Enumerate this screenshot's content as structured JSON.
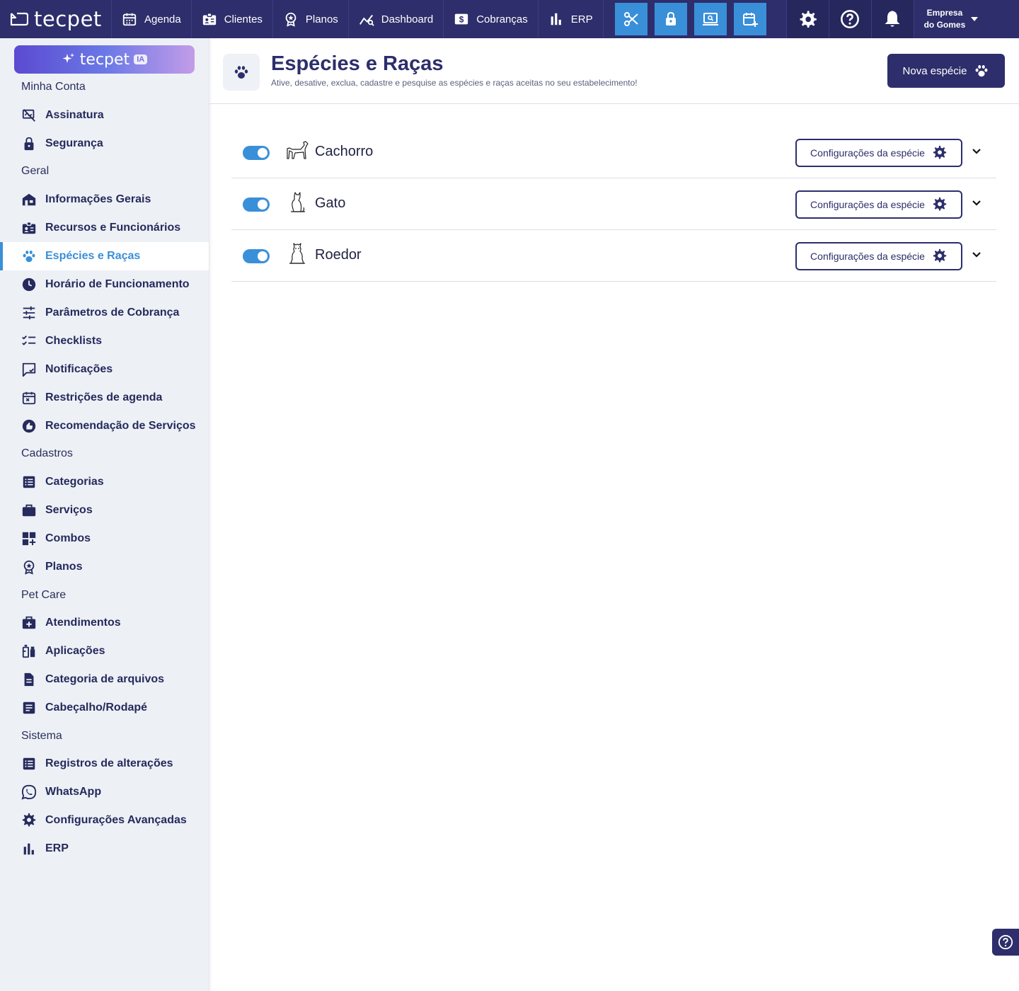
{
  "topbar": {
    "logo": "tecpet",
    "nav": [
      {
        "label": "Agenda",
        "icon": "calendar-icon"
      },
      {
        "label": "Clientes",
        "icon": "id-card-icon"
      },
      {
        "label": "Planos",
        "icon": "badge-icon"
      },
      {
        "label": "Dashboard",
        "icon": "chart-line-icon"
      },
      {
        "label": "Cobranças",
        "icon": "dollar-icon"
      },
      {
        "label": "ERP",
        "icon": "bar-chart-icon"
      }
    ],
    "quick_actions": [
      "scissors-icon",
      "lock-icon",
      "monitor-search-icon",
      "calendar-plus-icon"
    ],
    "tools": [
      "gear-icon",
      "help-icon",
      "bell-icon"
    ],
    "company_line1": "Empresa",
    "company_line2": "do Gomes"
  },
  "sidebar": {
    "ia_label": "tecpet",
    "ia_badge": "IA",
    "sections": {
      "account": "Minha Conta",
      "general": "Geral",
      "registry": "Cadastros",
      "petcare": "Pet Care",
      "system": "Sistema"
    },
    "items": {
      "assinatura": "Assinatura",
      "seguranca": "Segurança",
      "info": "Informações Gerais",
      "recursos": "Recursos e Funcionários",
      "especies": "Espécies e Raças",
      "horario": "Horário de Funcionamento",
      "parametros": "Parâmetros de Cobrança",
      "checklists": "Checklists",
      "notificacoes": "Notificações",
      "restricoes": "Restrições de agenda",
      "recomendacao": "Recomendação de Serviços",
      "categorias": "Categorias",
      "servicos": "Serviços",
      "combos": "Combos",
      "planos": "Planos",
      "atendimentos": "Atendimentos",
      "aplicacoes": "Aplicações",
      "cat_arquivos": "Categoria de arquivos",
      "cabecalho": "Cabeçalho/Rodapé",
      "registros": "Registros de alterações",
      "whatsapp": "WhatsApp",
      "config_avancadas": "Configurações Avançadas",
      "erp": "ERP"
    }
  },
  "page": {
    "title": "Espécies e Raças",
    "subtitle": "Ative, desative, exclua, cadastre e pesquise as espécies e raças aceitas no seu estabelecimento!",
    "new_button": "Nova espécie"
  },
  "species": [
    {
      "name": "Cachorro",
      "active": true,
      "config_label": "Configurações da espécie"
    },
    {
      "name": "Gato",
      "active": true,
      "config_label": "Configurações da espécie"
    },
    {
      "name": "Roedor",
      "active": true,
      "config_label": "Configurações da espécie"
    }
  ],
  "colors": {
    "primary": "#2d2e6b",
    "accent": "#3a8fd9",
    "sidebar_bg": "#edf1f6"
  }
}
